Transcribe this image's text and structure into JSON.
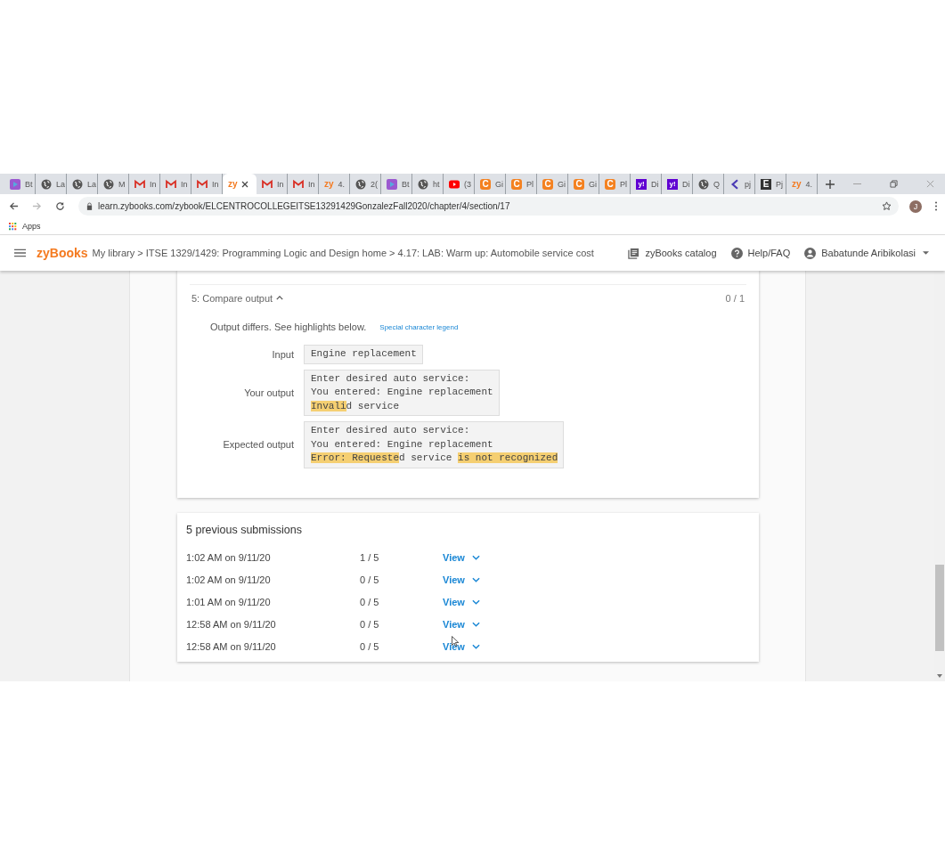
{
  "browser": {
    "tabs": [
      {
        "kind": "play",
        "label": "Bt",
        "selected": false
      },
      {
        "kind": "globe",
        "label": "La",
        "selected": false
      },
      {
        "kind": "globe",
        "label": "La",
        "selected": false
      },
      {
        "kind": "globe",
        "label": "M",
        "selected": false
      },
      {
        "kind": "gmail",
        "label": "In",
        "selected": false
      },
      {
        "kind": "gmail",
        "label": "In",
        "selected": false
      },
      {
        "kind": "gmail",
        "label": "In",
        "selected": false
      },
      {
        "kind": "zy",
        "favicon_text": "zy",
        "selected": true
      },
      {
        "kind": "gmail",
        "label": "In",
        "selected": false
      },
      {
        "kind": "gmail",
        "label": "In",
        "selected": false
      },
      {
        "kind": "zy",
        "favicon_text": "zy",
        "label": "4.",
        "selected": false
      },
      {
        "kind": "globe",
        "label": "2(",
        "selected": false
      },
      {
        "kind": "play",
        "label": "Bt",
        "selected": false
      },
      {
        "kind": "globe",
        "label": "ht",
        "selected": false
      },
      {
        "kind": "youtube",
        "label": "(3",
        "selected": false
      },
      {
        "kind": "c",
        "favicon_text": "C",
        "label": "Gi",
        "selected": false
      },
      {
        "kind": "c",
        "favicon_text": "C",
        "label": "Pl",
        "selected": false
      },
      {
        "kind": "c",
        "favicon_text": "C",
        "label": "Gi",
        "selected": false
      },
      {
        "kind": "c",
        "favicon_text": "C",
        "label": "Gi",
        "selected": false
      },
      {
        "kind": "c",
        "favicon_text": "C",
        "label": "Pl",
        "selected": false
      },
      {
        "kind": "yahoo",
        "favicon_text": "y!",
        "label": "Di",
        "selected": false
      },
      {
        "kind": "yahoo",
        "favicon_text": "y!",
        "label": "Di",
        "selected": false
      },
      {
        "kind": "globe",
        "label": "Q",
        "selected": false
      },
      {
        "kind": "back",
        "label": "pj",
        "selected": false
      },
      {
        "kind": "e",
        "favicon_text": "E",
        "label": "Pj",
        "selected": false
      },
      {
        "kind": "zy",
        "favicon_text": "zy",
        "label": "4.",
        "selected": false
      }
    ],
    "address": "learn.zybooks.com/zybook/ELCENTROCOLLEGEITSE13291429GonzalezFall2020/chapter/4/section/17",
    "bookmarks": [
      "Apps"
    ],
    "profile_initial": "J"
  },
  "header": {
    "logo": "zyBooks",
    "breadcrumb": "My library > ITSE 1329/1429: Programming Logic and Design home > 4.17: LAB: Warm up: Automobile service cost",
    "catalog": "zyBooks catalog",
    "help": "Help/FAQ",
    "user": "Babatunde Aribikolasi"
  },
  "compare": {
    "title": "5: Compare output",
    "expanded": true,
    "score": "0 / 1",
    "message": "Output differs. See highlights below.",
    "legend_link": "Special character legend",
    "rows": [
      {
        "label": "Input",
        "lines": [
          [
            {
              "text": "Engine replacement",
              "highlight": false
            }
          ]
        ]
      },
      {
        "label": "Your output",
        "lines": [
          [
            {
              "text": "Enter desired auto service:",
              "highlight": false
            }
          ],
          [
            {
              "text": "You entered: Engine replacement",
              "highlight": false
            }
          ],
          [
            {
              "text": "Invali",
              "highlight": true
            },
            {
              "text": "d service",
              "highlight": false
            }
          ]
        ]
      },
      {
        "label": "Expected output",
        "lines": [
          [
            {
              "text": "Enter desired auto service:",
              "highlight": false
            }
          ],
          [
            {
              "text": "You entered: Engine replacement",
              "highlight": false
            }
          ],
          [
            {
              "text": "Error: Requeste",
              "highlight": true
            },
            {
              "text": "d service ",
              "highlight": false
            },
            {
              "text": "is not recognized",
              "highlight": true
            }
          ]
        ]
      }
    ]
  },
  "submissions": {
    "title": "5 previous submissions",
    "rows": [
      {
        "time": "1:02 AM on 9/11/20",
        "score": "1 / 5",
        "action": "View"
      },
      {
        "time": "1:02 AM on 9/11/20",
        "score": "0 / 5",
        "action": "View"
      },
      {
        "time": "1:01 AM on 9/11/20",
        "score": "0 / 5",
        "action": "View"
      },
      {
        "time": "12:58 AM on 9/11/20",
        "score": "0 / 5",
        "action": "View"
      },
      {
        "time": "12:58 AM on 9/11/20",
        "score": "0 / 5",
        "action": "View"
      }
    ]
  }
}
